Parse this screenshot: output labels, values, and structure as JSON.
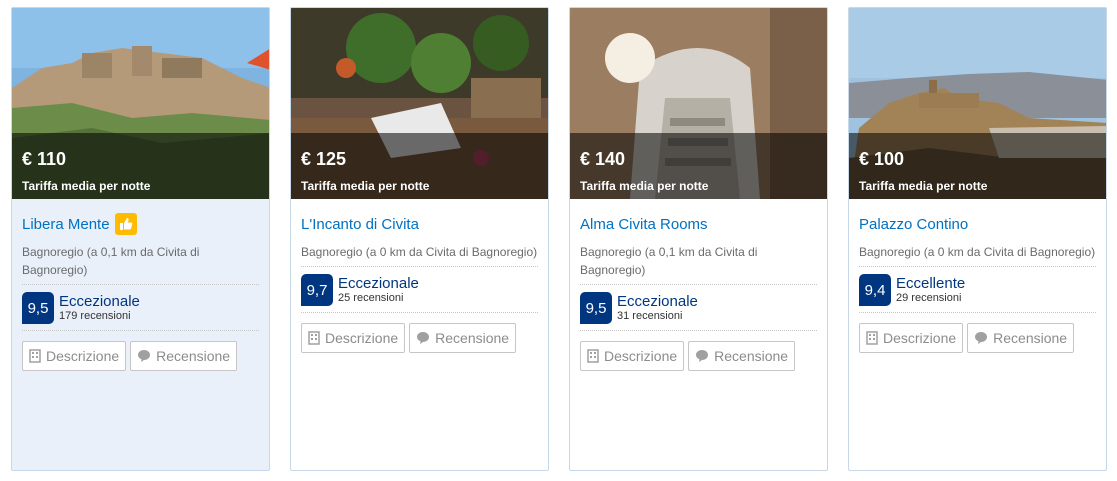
{
  "cards": [
    {
      "price": "€ 110",
      "per_night": "Tariffa media per notte",
      "name": "Libera Mente",
      "location": "Bagnoregio (a 0,1 km da Civita di Bagnoregio)",
      "score": "9,5",
      "rating_label": "Eccezionale",
      "reviews": "179 recensioni",
      "description_label": "Descrizione",
      "review_label": "Recensione",
      "has_thumb": true
    },
    {
      "price": "€ 125",
      "per_night": "Tariffa media per notte",
      "name": "L'Incanto di Civita",
      "location": "Bagnoregio (a 0 km da Civita di Bagnoregio)",
      "score": "9,7",
      "rating_label": "Eccezionale",
      "reviews": "25 recensioni",
      "description_label": "Descrizione",
      "review_label": "Recensione"
    },
    {
      "price": "€ 140",
      "per_night": "Tariffa media per notte",
      "name": "Alma Civita Rooms",
      "location": "Bagnoregio (a 0,1 km da Civita di Bagnoregio)",
      "score": "9,5",
      "rating_label": "Eccezionale",
      "reviews": "31 recensioni",
      "description_label": "Descrizione",
      "review_label": "Recensione"
    },
    {
      "price": "€ 100",
      "per_night": "Tariffa media per notte",
      "name": "Palazzo Contino",
      "location": "Bagnoregio (a 0 km da Civita di Bagnoregio)",
      "score": "9,4",
      "rating_label": "Eccellente",
      "reviews": "29 recensioni",
      "description_label": "Descrizione",
      "review_label": "Recensione"
    }
  ],
  "icons": {
    "thumb": "thumbs-up-icon",
    "description": "building-icon",
    "review": "speech-bubble-icon"
  },
  "colors": {
    "link": "#0071c2",
    "score_bg": "#003580",
    "thumb_bg": "#febb02",
    "highlight_bg": "#e9f0fa"
  }
}
